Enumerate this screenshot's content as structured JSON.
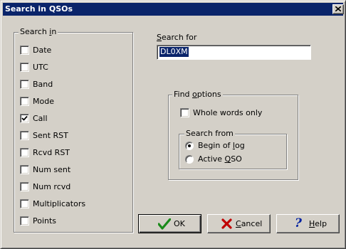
{
  "window": {
    "title": "Search in QSOs"
  },
  "search_in": {
    "label_pre": "Search ",
    "label_mn": "i",
    "label_post": "n",
    "items": [
      {
        "label": "Date",
        "checked": false
      },
      {
        "label": "UTC",
        "checked": false
      },
      {
        "label": "Band",
        "checked": false
      },
      {
        "label": "Mode",
        "checked": false
      },
      {
        "label": "Call",
        "checked": true
      },
      {
        "label": "Sent RST",
        "checked": false
      },
      {
        "label": "Rcvd RST",
        "checked": false
      },
      {
        "label": "Num sent",
        "checked": false
      },
      {
        "label": "Num rcvd",
        "checked": false
      },
      {
        "label": "Multiplicators",
        "checked": false
      },
      {
        "label": "Points",
        "checked": false
      }
    ]
  },
  "search_for": {
    "label_mn": "S",
    "label_post": "earch for",
    "value": "DL0XM"
  },
  "find_options": {
    "label_pre": "Find ",
    "label_mn": "o",
    "label_post": "ptions",
    "whole_words": {
      "label": "Whole words only",
      "checked": false
    }
  },
  "search_from": {
    "label": "Search from",
    "options": [
      {
        "pre": "Begin of ",
        "mn": "l",
        "post": "og",
        "selected": true
      },
      {
        "pre": "Active ",
        "mn": "Q",
        "post": "SO",
        "selected": false
      }
    ]
  },
  "buttons": {
    "ok": {
      "label": "OK"
    },
    "cancel": {
      "mn": "C",
      "post": "ancel"
    },
    "help": {
      "mn": "H",
      "post": "elp"
    }
  },
  "colors": {
    "titlebar": "#0a246a",
    "face": "#d4d0c8",
    "ok_check": "#1a8a1a",
    "cancel_x": "#c00000",
    "help_q": "#0020a0"
  }
}
